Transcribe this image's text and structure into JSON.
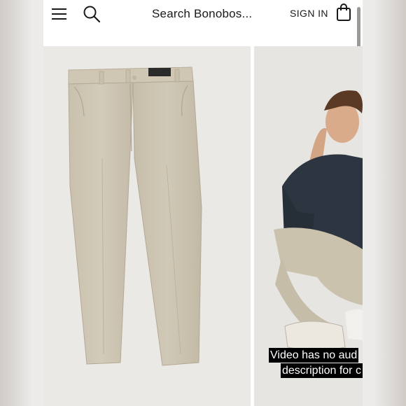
{
  "header": {
    "search_label": "Search Bonobos...",
    "signin_label": "SIGN IN",
    "icons": [
      "menu-icon",
      "search-icon",
      "shopping-bag-icon"
    ]
  },
  "gallery": {
    "main_image": "khaki chino pants flat lay",
    "second_image": "model wearing khaki chinos sitting",
    "video_caption_line1": "Video has no aud",
    "video_caption_line2": "description for c"
  },
  "colors": {
    "khaki": "#cfc6b4",
    "background": "#ebe9e5"
  }
}
